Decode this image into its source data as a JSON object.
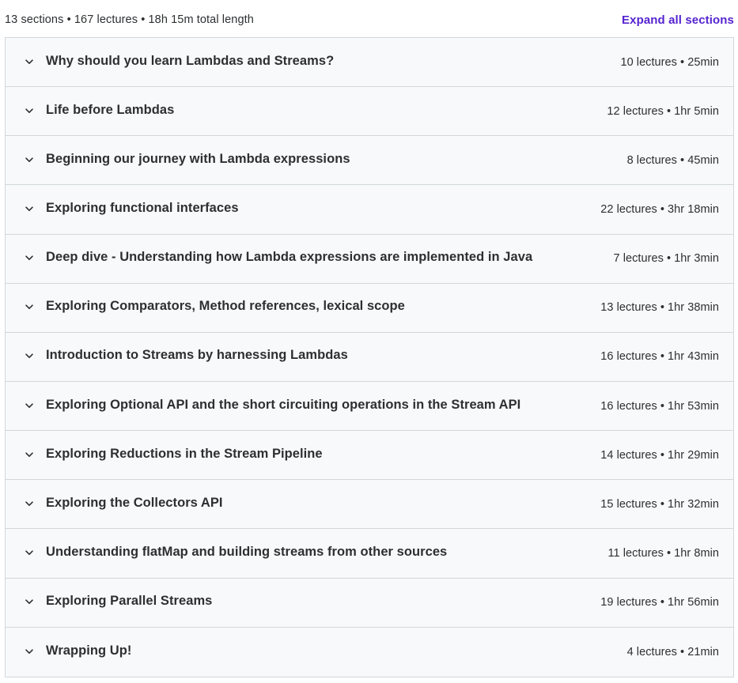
{
  "header": {
    "summary": "13 sections • 167 lectures • 18h 15m total length",
    "expand_label": "Expand all sections"
  },
  "colors": {
    "accent": "#5624d0",
    "text": "#2d2f31",
    "row_bg": "#f7f9fa",
    "border": "#d1d7dc"
  },
  "sections": [
    {
      "title": "Why should you learn Lambdas and Streams?",
      "meta": "10 lectures • 25min",
      "icon": "chevron-down-icon"
    },
    {
      "title": "Life before Lambdas",
      "meta": "12 lectures • 1hr 5min",
      "icon": "chevron-down-icon"
    },
    {
      "title": "Beginning our journey with Lambda expressions",
      "meta": "8 lectures • 45min",
      "icon": "chevron-down-icon"
    },
    {
      "title": "Exploring functional interfaces",
      "meta": "22 lectures • 3hr 18min",
      "icon": "chevron-down-icon"
    },
    {
      "title": "Deep dive - Understanding how Lambda expressions are implemented in Java",
      "meta": "7 lectures • 1hr 3min",
      "icon": "chevron-down-icon"
    },
    {
      "title": "Exploring Comparators, Method references, lexical scope",
      "meta": "13 lectures • 1hr 38min",
      "icon": "chevron-down-icon"
    },
    {
      "title": "Introduction to Streams by harnessing Lambdas",
      "meta": "16 lectures • 1hr 43min",
      "icon": "chevron-down-icon"
    },
    {
      "title": "Exploring Optional API and the short circuiting operations in the Stream API",
      "meta": "16 lectures • 1hr 53min",
      "icon": "chevron-down-icon"
    },
    {
      "title": "Exploring Reductions in the Stream Pipeline",
      "meta": "14 lectures • 1hr 29min",
      "icon": "chevron-down-icon"
    },
    {
      "title": "Exploring the Collectors API",
      "meta": "15 lectures • 1hr 32min",
      "icon": "chevron-down-icon"
    },
    {
      "title": "Understanding flatMap and building streams from other sources",
      "meta": "11 lectures • 1hr 8min",
      "icon": "chevron-down-icon"
    },
    {
      "title": "Exploring Parallel Streams",
      "meta": "19 lectures • 1hr 56min",
      "icon": "chevron-down-icon"
    },
    {
      "title": "Wrapping Up!",
      "meta": "4 lectures • 21min",
      "icon": "chevron-down-icon"
    }
  ]
}
